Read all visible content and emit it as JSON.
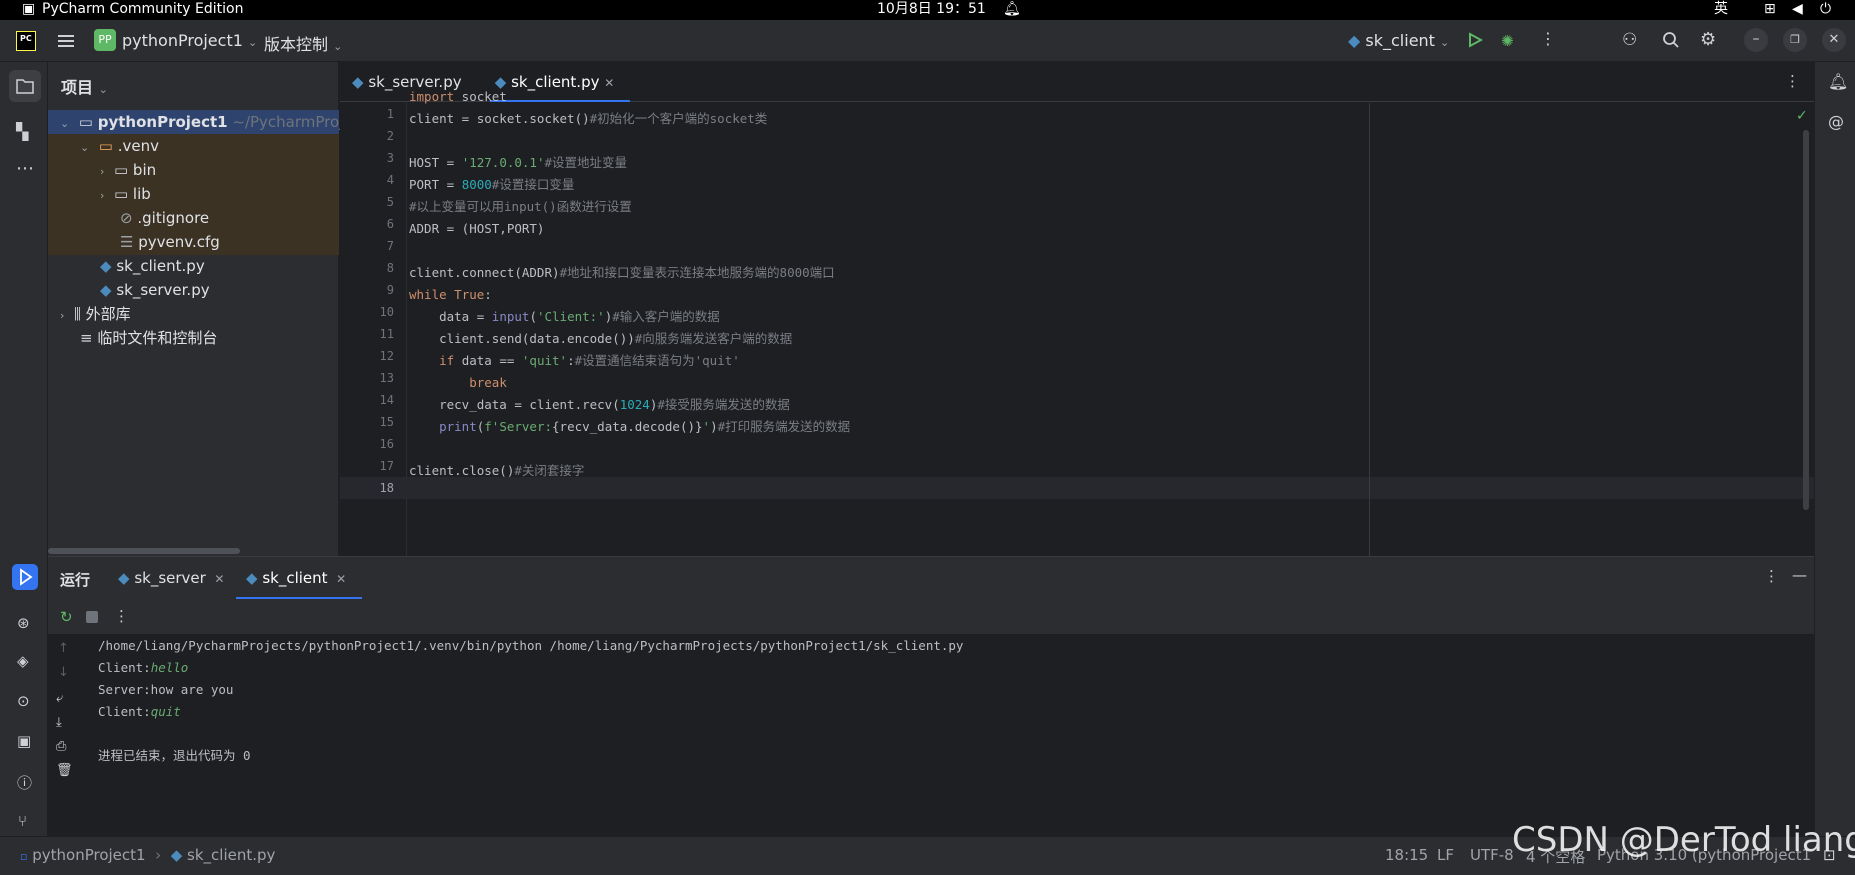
{
  "system_bar": {
    "app_name": "PyCharm Community Edition",
    "clock": "10月8日  19：51",
    "ime": "英"
  },
  "titlebar": {
    "project_badge": "PP",
    "project_name": "pythonProject1",
    "vcs_label": "版本控制",
    "run_config": "sk_client"
  },
  "project_panel": {
    "title": "项目",
    "root_name": "pythonProject1",
    "root_path": "~/PycharmProje",
    "venv": ".venv",
    "bin": "bin",
    "lib": "lib",
    "gitignore": ".gitignore",
    "pyvenv": "pyvenv.cfg",
    "sk_client": "sk_client.py",
    "sk_server": "sk_server.py",
    "ext_libs": "外部库",
    "scratches": "临时文件和控制台"
  },
  "editor": {
    "tabs": [
      {
        "label": "sk_server.py"
      },
      {
        "label": "sk_client.py"
      }
    ],
    "line_numbers": [
      "1",
      "2",
      "3",
      "4",
      "5",
      "6",
      "7",
      "8",
      "9",
      "10",
      "11",
      "12",
      "13",
      "14",
      "15",
      "16",
      "17",
      "18"
    ],
    "lines": {
      "l1a": "import",
      "l1b": " socket",
      "l2a": "client = socket.socket()",
      "l2b": "#初始化一个客户端的socket类",
      "l4a": "HOST = ",
      "l4b": "'127.0.0.1'",
      "l4c": "#设置地址变量",
      "l5a": "PORT = ",
      "l5b": "8000",
      "l5c": "#设置接口变量",
      "l6": "#以上变量可以用input()函数进行设置",
      "l7": "ADDR = (HOST,PORT)",
      "l9a": "client.connect(ADDR)",
      "l9b": "#地址和接口变量表示连接本地服务端的8000端口",
      "l10a": "while",
      "l10b": " ",
      "l10c": "True",
      "l10d": ":",
      "l11a": "    data = ",
      "l11b": "input",
      "l11c": "(",
      "l11d": "'Client:'",
      "l11e": ")",
      "l11f": "#输入客户端的数据",
      "l12a": "    client.send(data.encode())",
      "l12b": "#向服务端发送客户端的数据",
      "l13a": "    ",
      "l13b": "if",
      "l13c": " data == ",
      "l13d": "'quit'",
      "l13e": ":",
      "l13f": "#设置通信结束语句为'quit'",
      "l14a": "        ",
      "l14b": "break",
      "l15a": "    recv_data = client.recv(",
      "l15b": "1024",
      "l15c": ")",
      "l15d": "#接受服务端发送的数据",
      "l16a": "    ",
      "l16b": "print",
      "l16c": "(",
      "l16d": "f'Server:",
      "l16e": "{recv_data.decode()}",
      "l16f": "'",
      "l16g": ")",
      "l16h": "#打印服务端发送的数据",
      "l18a": "client.close()",
      "l18b": "#关闭套接字"
    }
  },
  "run_panel": {
    "title": "运行",
    "tabs": [
      {
        "label": "sk_server"
      },
      {
        "label": "sk_client"
      }
    ],
    "output": {
      "cmd": "/home/liang/PycharmProjects/pythonProject1/.venv/bin/python /home/liang/PycharmProjects/pythonProject1/sk_client.py",
      "c1_prefix": "Client:",
      "c1_input": "hello",
      "s1": "Server:how are you",
      "c2_prefix": "Client:",
      "c2_input": "quit",
      "exit": "进程已结束，退出代码为 0"
    }
  },
  "statusbar": {
    "breadcrumb_project": "pythonProject1",
    "breadcrumb_file": "sk_client.py",
    "position": "18:15",
    "line_sep": "LF",
    "encoding": "UTF-8",
    "indent": "4 个空格",
    "interpreter": "Python 3.10 (pythonProject1)"
  },
  "watermark": "CSDN @DerTod liang",
  "colors": {
    "accent": "#3574f0",
    "keyword": "#cf8e6d",
    "string": "#6aab73",
    "number": "#2aacb8",
    "comment": "#7a7e85",
    "venv_highlight": "#3b3224"
  }
}
